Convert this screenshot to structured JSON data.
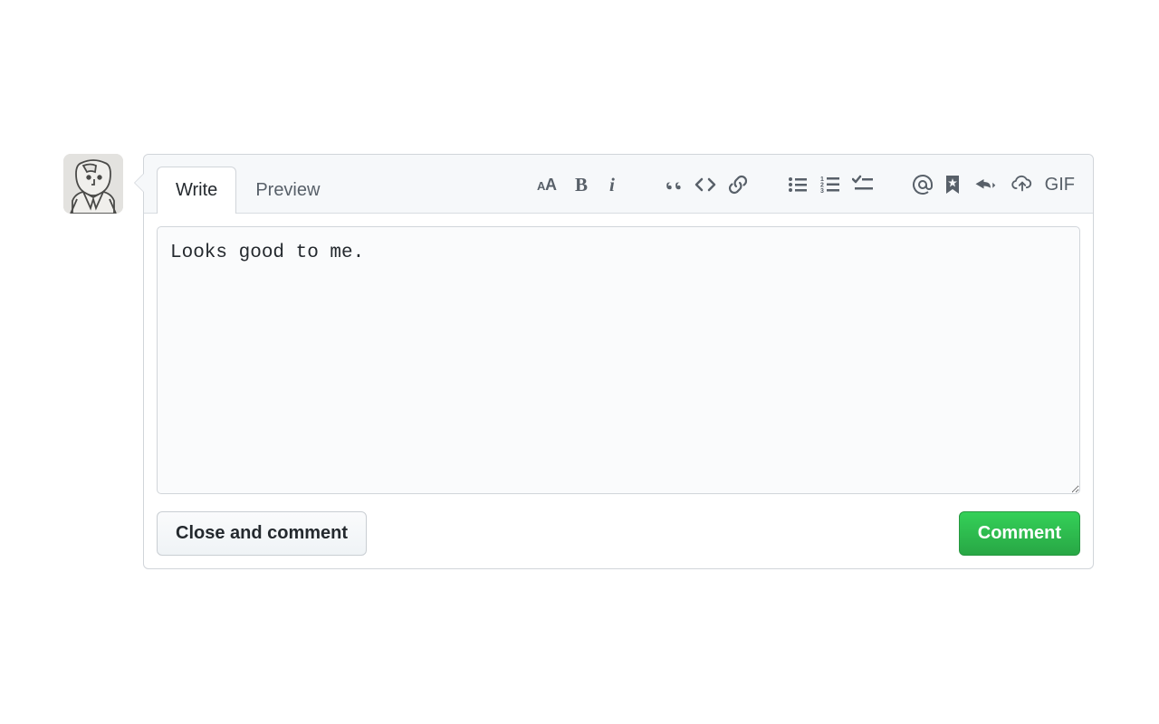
{
  "tabs": {
    "write": "Write",
    "preview": "Preview"
  },
  "toolbar": {
    "gif": "GIF"
  },
  "comment": {
    "value": "Looks good to me."
  },
  "buttons": {
    "close": "Close and comment",
    "comment": "Comment"
  }
}
